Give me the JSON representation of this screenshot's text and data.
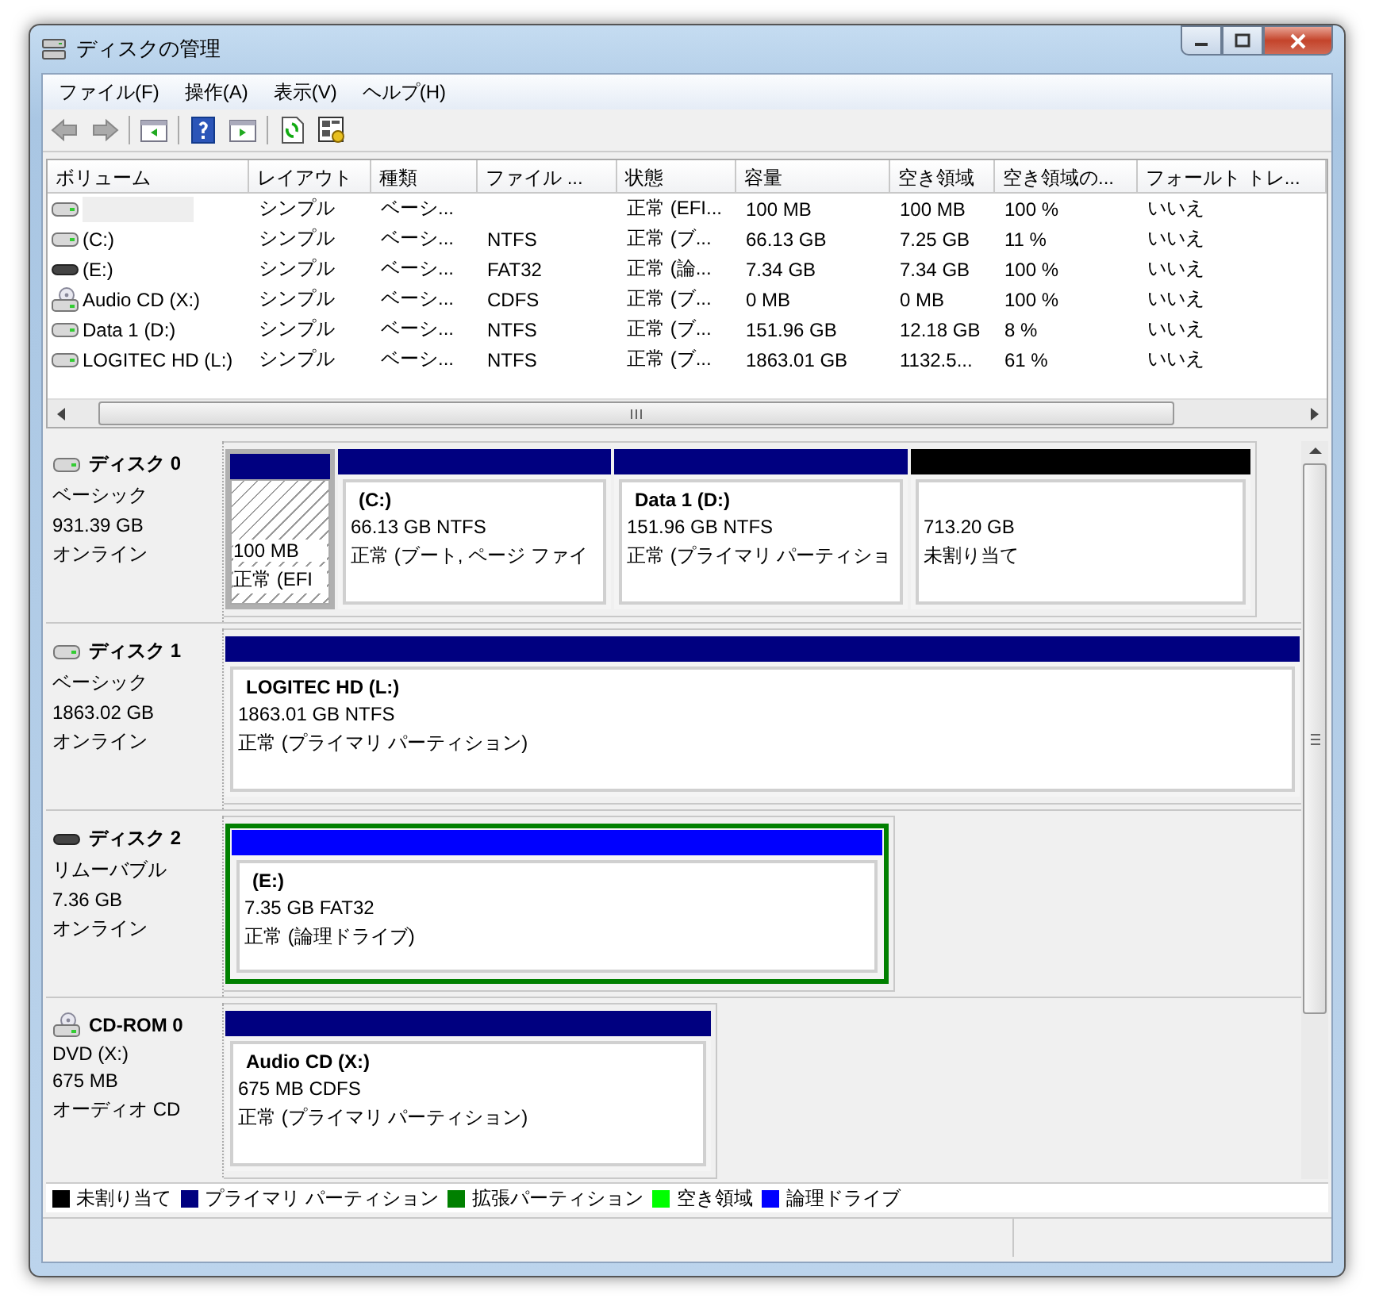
{
  "window": {
    "title": "ディスクの管理"
  },
  "menu": [
    "ファイル(F)",
    "操作(A)",
    "表示(V)",
    "ヘルプ(H)"
  ],
  "volume_table": {
    "columns": [
      "ボリューム",
      "レイアウト",
      "種類",
      "ファイル ...",
      "状態",
      "容量",
      "空き領域",
      "空き領域の...",
      "フォールト トレ..."
    ],
    "rows": [
      {
        "kind": "hdd",
        "cells": [
          "",
          "シンプル",
          "ベーシ...",
          "",
          "正常 (EFI...",
          "100 MB",
          "100 MB",
          "100 %",
          "いいえ"
        ]
      },
      {
        "kind": "hdd",
        "cells": [
          "(C:)",
          "シンプル",
          "ベーシ...",
          "NTFS",
          "正常 (ブ...",
          "66.13 GB",
          "7.25 GB",
          "11 %",
          "いいえ"
        ]
      },
      {
        "kind": "removable",
        "cells": [
          "(E:)",
          "シンプル",
          "ベーシ...",
          "FAT32",
          "正常 (論...",
          "7.34 GB",
          "7.34 GB",
          "100 %",
          "いいえ"
        ]
      },
      {
        "kind": "cd",
        "cells": [
          "Audio CD (X:)",
          "シンプル",
          "ベーシ...",
          "CDFS",
          "正常 (ブ...",
          "0 MB",
          "0 MB",
          "100 %",
          "いいえ"
        ]
      },
      {
        "kind": "hdd",
        "cells": [
          "Data 1 (D:)",
          "シンプル",
          "ベーシ...",
          "NTFS",
          "正常 (ブ...",
          "151.96 GB",
          "12.18 GB",
          "8 %",
          "いいえ"
        ]
      },
      {
        "kind": "hdd",
        "cells": [
          "LOGITEC HD (L:)",
          "シンプル",
          "ベーシ...",
          "NTFS",
          "正常 (ブ...",
          "1863.01 GB",
          "1132.5...",
          "61 %",
          "いいえ"
        ]
      }
    ]
  },
  "disks": [
    {
      "kind": "hdd",
      "name": "ディスク 0",
      "type": "ベーシック",
      "size": "931.39 GB",
      "status": "オンライン",
      "partitions": [
        {
          "kind": "hatched",
          "color": "#000080",
          "size": "100 MB",
          "status": "正常 (EFI"
        },
        {
          "kind": "plain",
          "color": "#000080",
          "label": "(C:)",
          "size": "66.13 GB NTFS",
          "status": "正常 (ブート, ページ ファイ"
        },
        {
          "kind": "plain",
          "color": "#000080",
          "label": "Data 1  (D:)",
          "size": "151.96 GB NTFS",
          "status": "正常 (プライマリ パーティショ"
        },
        {
          "kind": "plain",
          "color": "#000000",
          "size": "713.20 GB",
          "status": "未割り当て"
        }
      ]
    },
    {
      "kind": "hdd",
      "name": "ディスク 1",
      "type": "ベーシック",
      "size": "1863.02 GB",
      "status": "オンライン",
      "partitions": [
        {
          "kind": "plain",
          "color": "#000080",
          "label": "LOGITEC HD  (L:)",
          "size": "1863.01 GB NTFS",
          "status": "正常 (プライマリ パーティション)"
        }
      ]
    },
    {
      "kind": "removable",
      "name": "ディスク 2",
      "type": "リムーバブル",
      "size": "7.36 GB",
      "status": "オンライン",
      "partitions": [
        {
          "kind": "extended",
          "color": "#0000ff",
          "label": "(E:)",
          "size": "7.35 GB FAT32",
          "status": "正常 (論理ドライブ)"
        }
      ]
    },
    {
      "kind": "cd",
      "name": "CD-ROM 0",
      "type": "DVD (X:)",
      "size": "675 MB",
      "status": "オーディオ CD",
      "partitions": [
        {
          "kind": "plain",
          "color": "#000080",
          "label": "Audio CD  (X:)",
          "size": "675 MB CDFS",
          "status": "正常 (プライマリ パーティション)"
        }
      ]
    }
  ],
  "legend": [
    {
      "label": "未割り当て",
      "color": "#000000"
    },
    {
      "label": "プライマリ パーティション",
      "color": "#000080"
    },
    {
      "label": "拡張パーティション",
      "color": "#008000"
    },
    {
      "label": "空き領域",
      "color": "#00ff00"
    },
    {
      "label": "論理ドライブ",
      "color": "#0000ff"
    }
  ]
}
